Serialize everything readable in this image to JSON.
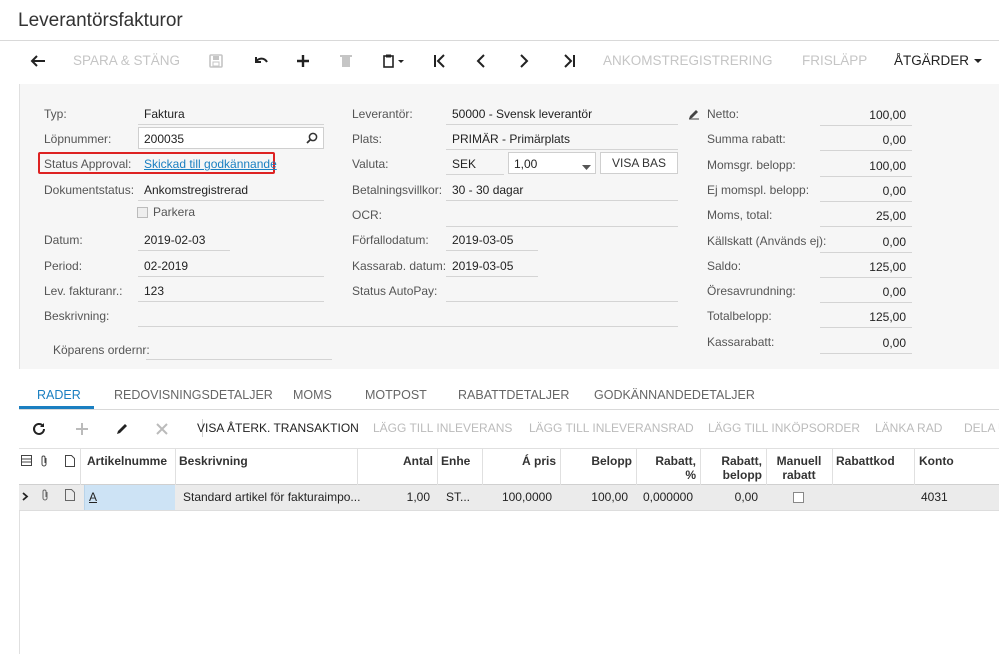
{
  "page": {
    "title": "Leverantörsfakturor"
  },
  "toolbar": {
    "save_close": "SPARA & STÄNG",
    "receipt_registration": "ANKOMSTREGISTRERING",
    "release": "FRISLÄPP",
    "actions": "ÅTGÄRDER"
  },
  "form": {
    "typ_label": "Typ:",
    "typ_value": "Faktura",
    "lopnummer_label": "Löpnummer:",
    "lopnummer_value": "200035",
    "status_approval_label": "Status Approval:",
    "status_approval_value": "Skickad till godkännande",
    "dokumentstatus_label": "Dokumentstatus:",
    "dokumentstatus_value": "Ankomstregistrerad",
    "parkera_label": "Parkera",
    "datum_label": "Datum:",
    "datum_value": "2019-02-03",
    "period_label": "Period:",
    "period_value": "02-2019",
    "lev_fakturanr_label": "Lev. fakturanr.:",
    "lev_fakturanr_value": "123",
    "beskrivning_label": "Beskrivning:",
    "koparens_ordernr_label": "Köparens ordernr:",
    "leverantor_label": "Leverantör:",
    "leverantor_value": "50000 - Svensk leverantör",
    "plats_label": "Plats:",
    "plats_value": "PRIMÄR - Primärplats",
    "valuta_label": "Valuta:",
    "valuta_value": "SEK",
    "kurs_value": "1,00",
    "visa_bas": "VISA BAS",
    "betalningsvillkor_label": "Betalningsvillkor:",
    "betalningsvillkor_value": "30 - 30 dagar",
    "ocr_label": "OCR:",
    "forfallodatum_label": "Förfallodatum:",
    "forfallodatum_value": "2019-03-05",
    "kassarab_datum_label": "Kassarab. datum:",
    "kassarab_datum_value": "2019-03-05",
    "status_autopay_label": "Status AutoPay:"
  },
  "totals": [
    {
      "label": "Netto:",
      "value": "100,00"
    },
    {
      "label": "Summa rabatt:",
      "value": "0,00"
    },
    {
      "label": "Momsgr. belopp:",
      "value": "100,00"
    },
    {
      "label": "Ej momspl. belopp:",
      "value": "0,00"
    },
    {
      "label": "Moms, total:",
      "value": "25,00"
    },
    {
      "label": "Källskatt (Används ej):",
      "value": "0,00"
    },
    {
      "label": "Saldo:",
      "value": "125,00"
    },
    {
      "label": "Öresavrundning:",
      "value": "0,00"
    },
    {
      "label": "Totalbelopp:",
      "value": "125,00"
    },
    {
      "label": "Kassarabatt:",
      "value": "0,00"
    }
  ],
  "tabs": [
    "RADER",
    "REDOVISNINGSDETALJER",
    "MOMS",
    "MOTPOST",
    "RABATTDETALJER",
    "GODKÄNNANDEDETALJER"
  ],
  "grid_toolbar": {
    "view_transaction": "VISA ÅTERK. TRANSAKTION",
    "add_receipt": "LÄGG TILL INLEVERANS",
    "add_receipt_line": "LÄGG TILL INLEVERANSRAD",
    "add_po": "LÄGG TILL INKÖPSORDER",
    "link_line": "LÄNKA RAD",
    "split": "DELA U"
  },
  "grid": {
    "headers": {
      "artikelnummer": "Artikelnumme",
      "beskrivning": "Beskrivning",
      "antal": "Antal",
      "enhet": "Enhe",
      "a_pris": "Á pris",
      "belopp": "Belopp",
      "rabatt_pct_1": "Rabatt,",
      "rabatt_pct_2": "%",
      "rabatt_belopp_1": "Rabatt,",
      "rabatt_belopp_2": "belopp",
      "manuell_rabatt_1": "Manuell",
      "manuell_rabatt_2": "rabatt",
      "rabattkod": "Rabattkod",
      "konto": "Konto"
    },
    "rows": [
      {
        "artikelnummer": "A",
        "beskrivning": "Standard artikel för fakturaimpo...",
        "antal": "1,00",
        "enhet": "ST...",
        "a_pris": "100,0000",
        "belopp": "100,00",
        "rabatt_pct": "0,000000",
        "rabatt_belopp": "0,00",
        "konto": "4031"
      }
    ]
  },
  "colors": {
    "accent": "#1a7fc1",
    "highlight": "#dd2222"
  }
}
